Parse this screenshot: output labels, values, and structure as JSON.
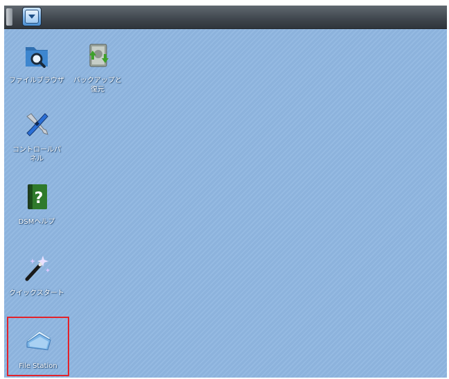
{
  "desktop": {
    "icons": [
      {
        "label": "ファイルブラウザ",
        "icon": "folder-search-icon"
      },
      {
        "label": "バックアップと\n復元",
        "icon": "backup-restore-icon"
      },
      {
        "label": "コントロールパ\nネル",
        "icon": "control-panel-icon"
      },
      {
        "label": "DSMヘルプ",
        "icon": "help-book-icon"
      },
      {
        "label": "クイックスタート",
        "icon": "magic-wand-icon"
      },
      {
        "label": "File Station",
        "icon": "file-station-icon"
      }
    ]
  },
  "colors": {
    "desktop_bg": "#8fb6e0",
    "taskbar": "#3f464d",
    "highlight": "#e3222a"
  }
}
